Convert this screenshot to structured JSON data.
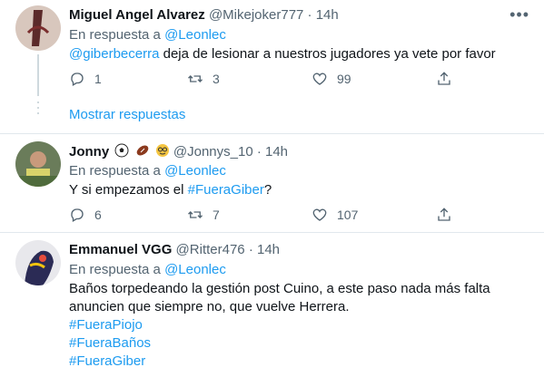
{
  "tweets": [
    {
      "name": "Miguel Angel Alvarez",
      "handle": "@Mikejoker777",
      "separator": "·",
      "time": "14h",
      "reply_prefix": "En respuesta a",
      "reply_handle": "@Leonlec",
      "body_mention": "@giberbecerra",
      "body_text": " deja de lesionar a nuestros jugadores ya vete por favor",
      "replies": "1",
      "retweets": "3",
      "likes": "99"
    },
    {
      "name": "Jonny",
      "handle": "@Jonnys_10",
      "separator": "·",
      "time": "14h",
      "emojis": [
        "soccer-ball-icon",
        "football-icon",
        "nerd-face-icon"
      ],
      "reply_prefix": "En respuesta a",
      "reply_handle": "@Leonlec",
      "body_pre": "Y si empezamos el ",
      "body_hashtag": "#FueraGiber",
      "body_post": "?",
      "replies": "6",
      "retweets": "7",
      "likes": "107"
    },
    {
      "name": "Emmanuel VGG",
      "handle": "@Ritter476",
      "separator": "·",
      "time": "14h",
      "reply_prefix": "En respuesta a",
      "reply_handle": "@Leonlec",
      "body_line1": "Baños torpedeando la gestión post Cuino, a este paso nada más falta",
      "body_line2": "anuncien que siempre no, que vuelve Herrera.",
      "hashtags": [
        "#FueraPiojo",
        "#FueraBaños",
        "#FueraGiber"
      ]
    }
  ],
  "show_replies_label": "Mostrar respuestas",
  "colors": {
    "link": "#1d9bf0",
    "secondary": "#536471",
    "divider": "#e1e8ed"
  }
}
